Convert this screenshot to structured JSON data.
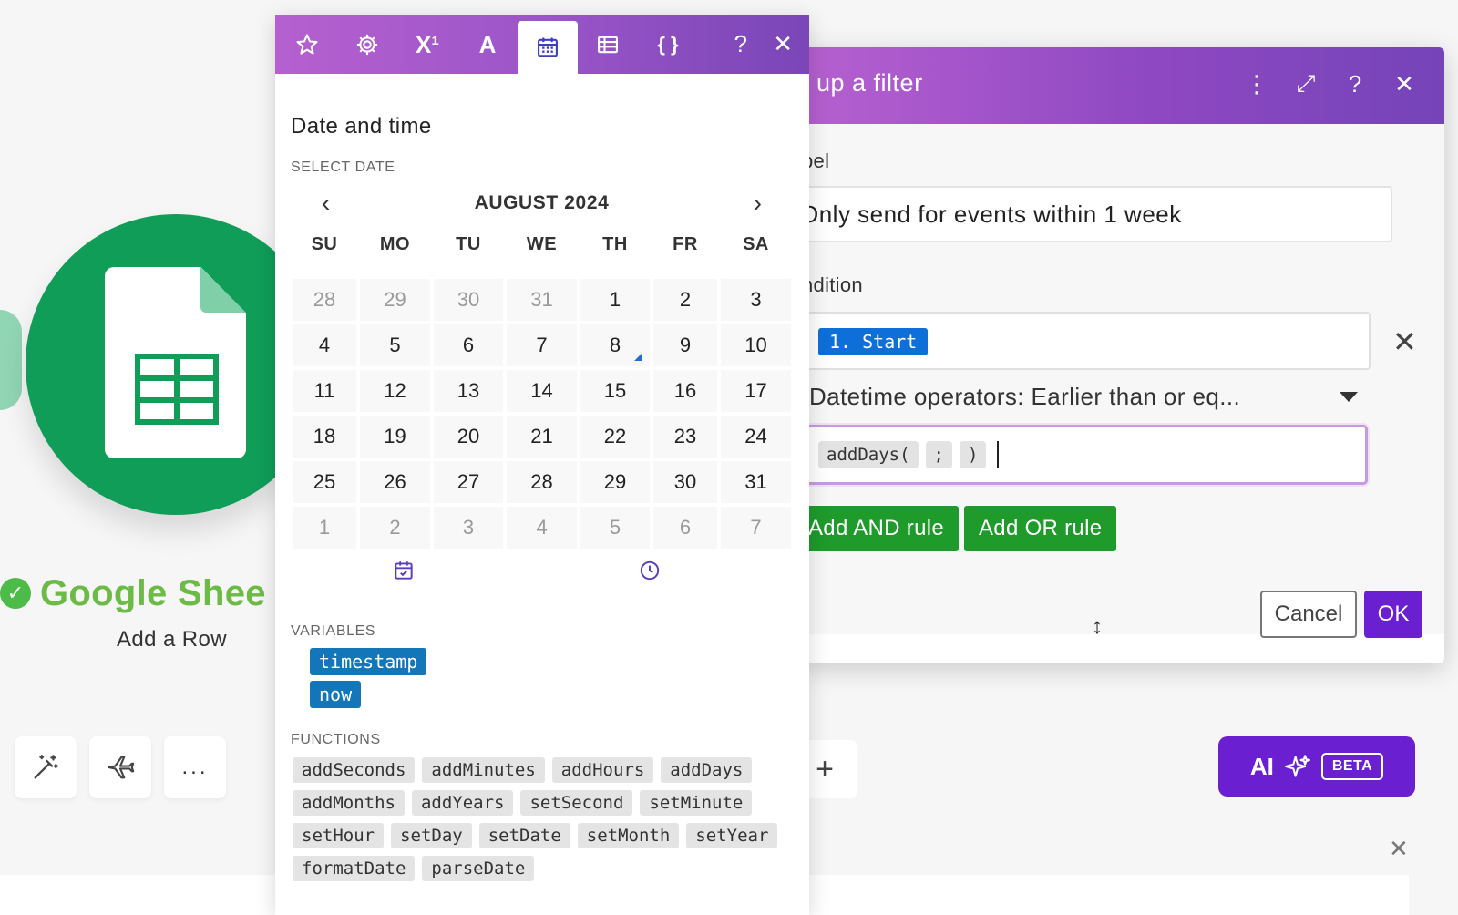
{
  "canvas": {
    "module_title": "Google Shee",
    "module_subtitle": "Add a Row",
    "tools": [
      "magic-wand-icon",
      "airplane-icon",
      "more-icon"
    ],
    "more_label": "...",
    "plus_label": "+",
    "ai_button": {
      "label": "AI",
      "badge": "BETA"
    },
    "close_label": "✕"
  },
  "filter": {
    "title": "t up a filter",
    "label_caption": "bel",
    "label_value": "Only send for events within 1 week",
    "condition_caption": "ndition",
    "condition_token": "1. Start",
    "operator": "Datetime operators: Earlier than or eq...",
    "expression_tokens": [
      "addDays(",
      ";",
      ")"
    ],
    "add_and": "Add AND rule",
    "add_or": "Add OR rule",
    "cancel": "Cancel",
    "ok": "OK",
    "header_icons": {
      "menu": "⋮",
      "expand": "⤢",
      "help": "?",
      "close": "✕"
    },
    "remove_label": "✕",
    "resize_label": "↕"
  },
  "mapper": {
    "tabs": [
      "star-icon",
      "gear-icon",
      "superscript-icon",
      "text-icon",
      "calendar-icon",
      "table-icon",
      "braces-icon"
    ],
    "active_tab": "calendar-icon",
    "superscript_label": "X¹",
    "text_label": "A",
    "braces_label": "{ }",
    "help_label": "?",
    "close_label": "✕",
    "section_title": "Date and time",
    "select_date_heading": "SELECT DATE",
    "month_label": "AUGUST 2024",
    "prev_label": "‹",
    "next_label": "›",
    "weekdays": [
      "SU",
      "MO",
      "TU",
      "WE",
      "TH",
      "FR",
      "SA"
    ],
    "days": [
      {
        "d": "28",
        "muted": true
      },
      {
        "d": "29",
        "muted": true
      },
      {
        "d": "30",
        "muted": true
      },
      {
        "d": "31",
        "muted": true
      },
      {
        "d": "1"
      },
      {
        "d": "2"
      },
      {
        "d": "3"
      },
      {
        "d": "4"
      },
      {
        "d": "5"
      },
      {
        "d": "6"
      },
      {
        "d": "7"
      },
      {
        "d": "8",
        "today": true
      },
      {
        "d": "9"
      },
      {
        "d": "10"
      },
      {
        "d": "11"
      },
      {
        "d": "12"
      },
      {
        "d": "13"
      },
      {
        "d": "14"
      },
      {
        "d": "15"
      },
      {
        "d": "16"
      },
      {
        "d": "17"
      },
      {
        "d": "18"
      },
      {
        "d": "19"
      },
      {
        "d": "20"
      },
      {
        "d": "21"
      },
      {
        "d": "22"
      },
      {
        "d": "23"
      },
      {
        "d": "24"
      },
      {
        "d": "25"
      },
      {
        "d": "26"
      },
      {
        "d": "27"
      },
      {
        "d": "28"
      },
      {
        "d": "29"
      },
      {
        "d": "30"
      },
      {
        "d": "31"
      },
      {
        "d": "1",
        "muted": true
      },
      {
        "d": "2",
        "muted": true
      },
      {
        "d": "3",
        "muted": true
      },
      {
        "d": "4",
        "muted": true
      },
      {
        "d": "5",
        "muted": true
      },
      {
        "d": "6",
        "muted": true
      },
      {
        "d": "7",
        "muted": true
      }
    ],
    "variables_heading": "VARIABLES",
    "variables": [
      "timestamp",
      "now"
    ],
    "functions_heading": "FUNCTIONS",
    "functions": [
      "addSeconds",
      "addMinutes",
      "addHours",
      "addDays",
      "addMonths",
      "addYears",
      "setSecond",
      "setMinute",
      "setHour",
      "setDay",
      "setDate",
      "setMonth",
      "setYear",
      "formatDate",
      "parseDate"
    ]
  },
  "colors": {
    "brand_purple": "#6a1fd0",
    "tab_gradient_start": "#b660d0",
    "rule_green": "#1e9b2b",
    "variable_blue": "#1276b8",
    "sheets_green": "#0f9d58"
  }
}
